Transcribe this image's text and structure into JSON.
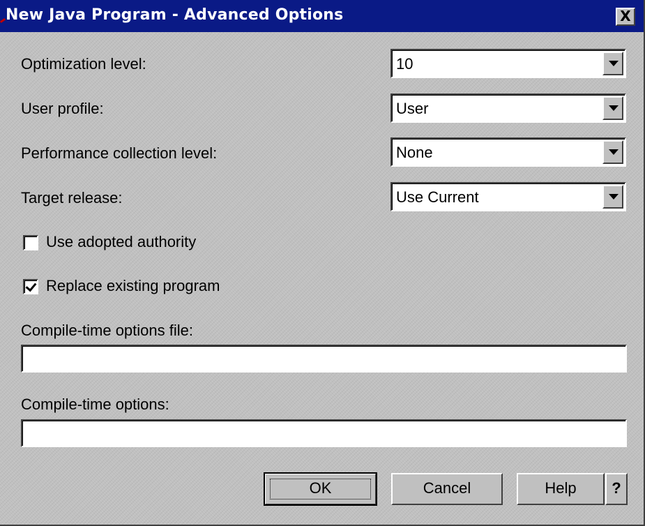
{
  "window": {
    "title": "New Java Program - Advanced Options",
    "close_glyph": "X"
  },
  "options": {
    "optimization_level": {
      "label": "Optimization level:",
      "value": "10"
    },
    "user_profile": {
      "label": "User profile:",
      "value": "User"
    },
    "performance_collection_level": {
      "label": "Performance collection level:",
      "value": "None"
    },
    "target_release": {
      "label": "Target release:",
      "value": "Use Current"
    }
  },
  "checkboxes": {
    "use_adopted_authority": {
      "label": "Use adopted authority",
      "checked": false
    },
    "replace_existing_program": {
      "label": "Replace existing program",
      "checked": true
    }
  },
  "fields": {
    "compile_time_options_file": {
      "label": "Compile-time options file:",
      "value": ""
    },
    "compile_time_options": {
      "label": "Compile-time options:",
      "value": ""
    }
  },
  "buttons": {
    "ok": "OK",
    "cancel": "Cancel",
    "help": "Help",
    "context_help": "?"
  },
  "colors": {
    "titlebar": "#0a1a86",
    "face": "#c0c0c0"
  },
  "icons": {
    "close": "close-icon",
    "dropdown": "chevron-down-icon",
    "checkmark": "checkmark-icon"
  }
}
